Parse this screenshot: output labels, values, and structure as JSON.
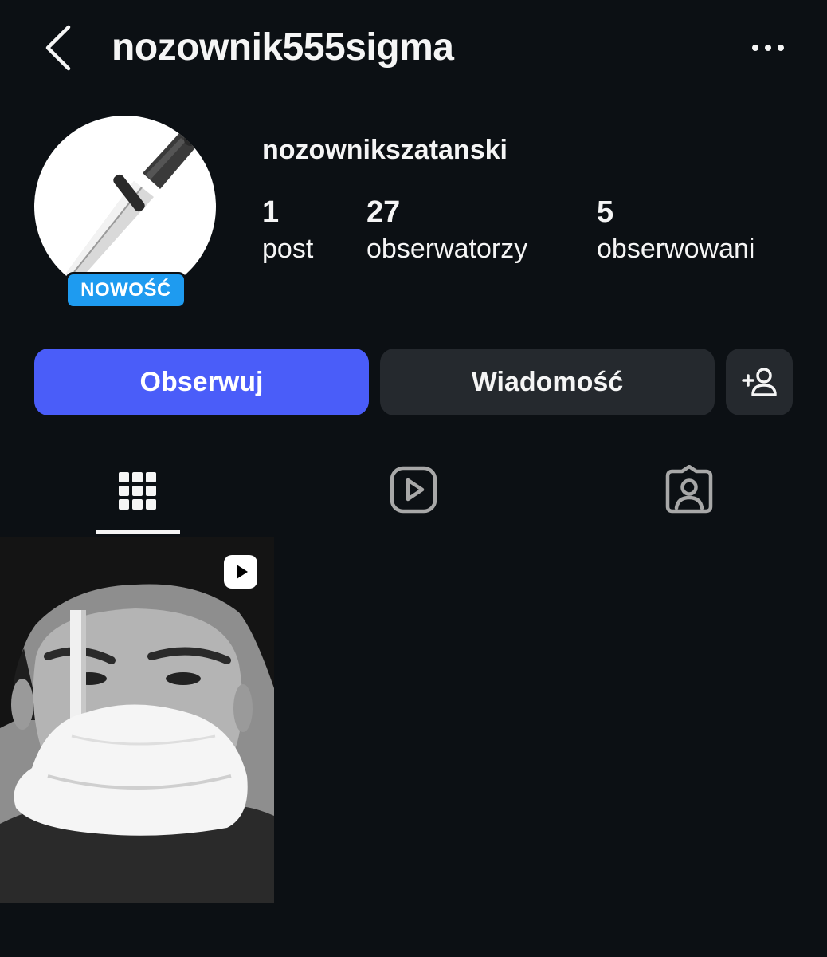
{
  "header": {
    "username": "nozownik555sigma",
    "back_icon": "chevron-left-icon",
    "more_icon": "more-horizontal-icon"
  },
  "profile": {
    "display_name": "nozownikszatanski",
    "badge": "NOWOŚĆ",
    "avatar_icon": "knife-avatar-image",
    "badge_color": "#1e9bf0"
  },
  "stats": {
    "posts_value": "1",
    "posts_label": "post",
    "followers_value": "27",
    "followers_label": "obserwatorzy",
    "following_value": "5",
    "following_label": "obserwowani"
  },
  "actions": {
    "follow_label": "Obserwuj",
    "message_label": "Wiadomość",
    "add_person_icon": "add-person-icon",
    "follow_color": "#4a5df9",
    "secondary_color": "#25292e"
  },
  "tabs": {
    "grid_icon": "grid-icon",
    "reels_icon": "reels-icon",
    "tagged_icon": "tagged-icon",
    "active": "grid"
  },
  "posts": [
    {
      "type": "reel",
      "icon": "reel-play-icon"
    }
  ],
  "colors": {
    "background": "#0c1014",
    "text": "#f5f5f5"
  }
}
